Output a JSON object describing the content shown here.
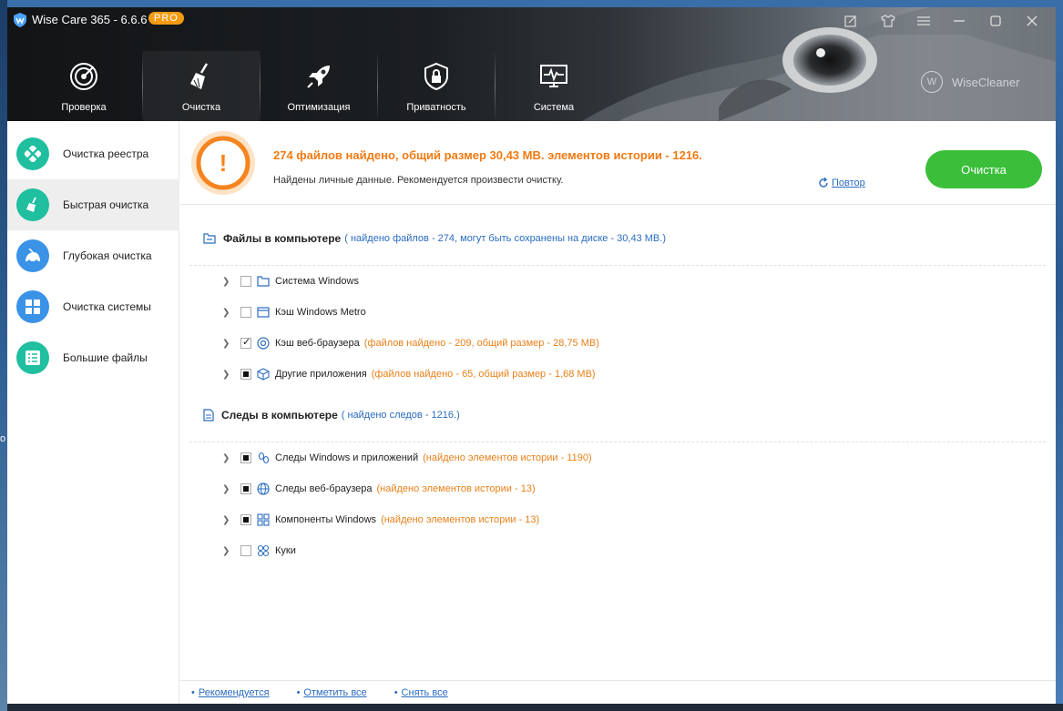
{
  "window": {
    "app_title": "Wise Care 365 - 6.6.6",
    "badge": "PRO",
    "brand": "WiseCleaner",
    "brand_mark": "W"
  },
  "nav": {
    "items": [
      {
        "label": "Проверка",
        "icon": "radar-icon"
      },
      {
        "label": "Очистка",
        "icon": "broom-icon",
        "active": true
      },
      {
        "label": "Оптимизация",
        "icon": "rocket-icon"
      },
      {
        "label": "Приватность",
        "icon": "lock-shield-icon"
      },
      {
        "label": "Система",
        "icon": "monitor-pulse-icon"
      }
    ]
  },
  "sidebar": {
    "items": [
      {
        "label": "Очистка реестра",
        "icon": "registry-icon"
      },
      {
        "label": "Быстрая очистка",
        "icon": "broom-icon",
        "active": true
      },
      {
        "label": "Глубокая очистка",
        "icon": "vacuum-icon"
      },
      {
        "label": "Очистка системы",
        "icon": "windows-icon"
      },
      {
        "label": "Большие файлы",
        "icon": "file-list-icon"
      }
    ]
  },
  "summary": {
    "title": "274 файлов найдено, общий размер 30,43 MB. элементов истории - 1216.",
    "subtitle": "Найдены личные данные. Рекомендуется произвести очистку.",
    "retry": "Повтор",
    "clean_button": "Очистка",
    "warn_mark": "!"
  },
  "files_section": {
    "title": "Файлы в компьютере",
    "detail": "( найдено файлов - 274, могут быть сохранены на диске - 30,43 MB.)",
    "rows": [
      {
        "label": "Система Windows",
        "info": "",
        "state": "unchecked"
      },
      {
        "label": "Кэш Windows Metro",
        "info": "",
        "state": "unchecked"
      },
      {
        "label": "Кэш веб-браузера",
        "info": "(файлов найдено - 209, общий размер - 28,75 MB)",
        "state": "checked"
      },
      {
        "label": "Другие приложения",
        "info": "(файлов найдено - 65, общий размер - 1,68 MB)",
        "state": "partial"
      }
    ]
  },
  "traces_section": {
    "title": "Следы в компьютере",
    "detail": "( найдено следов - 1216.)",
    "rows": [
      {
        "label": "Следы Windows и приложений",
        "info": "(найдено элементов истории - 1190)",
        "state": "partial"
      },
      {
        "label": "Следы веб-браузера",
        "info": "(найдено элементов истории - 13)",
        "state": "partial"
      },
      {
        "label": "Компоненты Windows",
        "info": "(найдено элементов истории - 13)",
        "state": "partial"
      },
      {
        "label": "Куки",
        "info": "",
        "state": "unchecked"
      }
    ]
  },
  "footer": {
    "recommended": "Рекомендуется",
    "select_all": "Отметить все",
    "deselect_all": "Снять все"
  },
  "colors": {
    "accent_orange": "#f07a12",
    "link_blue": "#2a6cc0",
    "clean_green": "#3bbf3b",
    "teal": "#1fbfa0"
  }
}
